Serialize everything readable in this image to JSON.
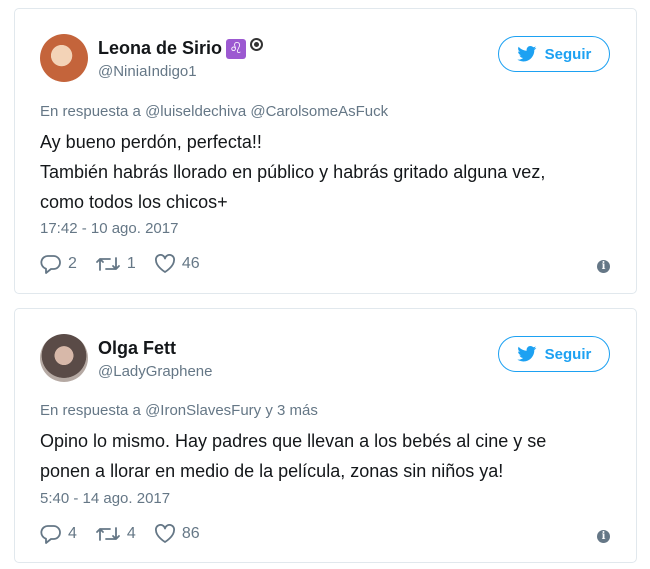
{
  "tweets": [
    {
      "name": "Leona de Sirio",
      "emoji_badge": "♌",
      "handle": "@NiniaIndigo1",
      "follow_label": "Seguir",
      "reply_to": "En respuesta a @luiseldechiva @CarolsomeAsFuck",
      "text_lines": [
        "Ay bueno perdón, perfecta!!",
        "También habrás llorado en público y habrás gritado alguna vez,",
        "como todos los chicos+"
      ],
      "timestamp": "17:42 - 10 ago. 2017",
      "replies": "2",
      "retweets": "1",
      "likes": "46"
    },
    {
      "name": "Olga Fett",
      "handle": "@LadyGraphene",
      "follow_label": "Seguir",
      "reply_to": "En respuesta a @IronSlavesFury y 3 más",
      "text_lines": [
        "Opino lo mismo. Hay padres que llevan a los bebés al cine y se",
        "ponen a llorar en medio de la película, zonas sin niños ya!"
      ],
      "timestamp": "5:40 - 14 ago. 2017",
      "replies": "4",
      "retweets": "4",
      "likes": "86"
    }
  ],
  "colors": {
    "accent": "#1da1f2",
    "secondary_text": "#657786",
    "border": "#e1e8ed",
    "badge": "#9c59d1"
  },
  "icons": [
    "reply-icon",
    "retweet-icon",
    "like-icon",
    "info-icon",
    "twitter-bird-icon"
  ]
}
